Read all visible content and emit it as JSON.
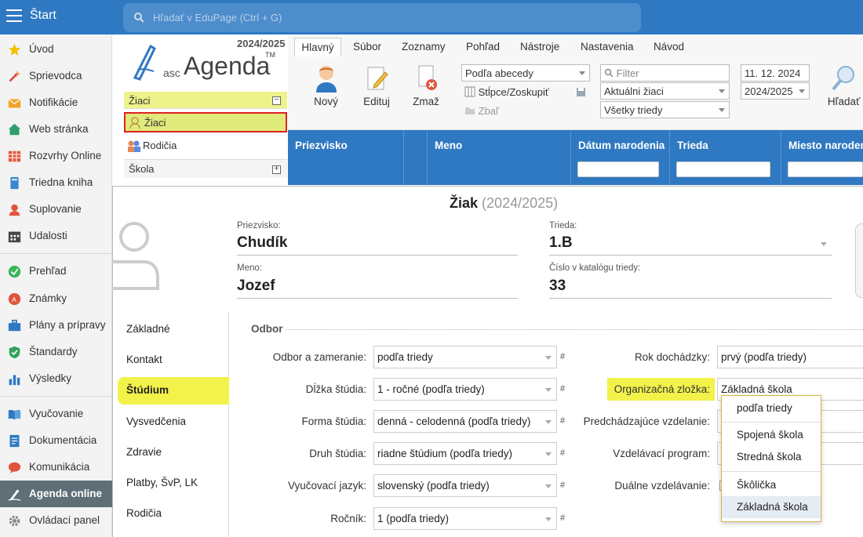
{
  "topbar": {
    "title": "Štart",
    "search_placeholder": "Hľadať v EduPage (Ctrl + G)"
  },
  "sidebar": {
    "items": [
      {
        "label": "Úvod",
        "icon": "star-icon"
      },
      {
        "label": "Sprievodca",
        "icon": "wand-icon"
      },
      {
        "label": "Notifikácie",
        "icon": "envelope-icon"
      },
      {
        "label": "Web stránka",
        "icon": "home-icon"
      },
      {
        "label": "Rozvrhy Online",
        "icon": "grid-icon"
      },
      {
        "label": "Triedna kniha",
        "icon": "book-icon"
      },
      {
        "label": "Suplovanie",
        "icon": "person-icon"
      },
      {
        "label": "Udalosti",
        "icon": "calendar-icon"
      },
      {
        "label": "Prehľad",
        "icon": "check-icon"
      },
      {
        "label": "Známky",
        "icon": "grade-icon"
      },
      {
        "label": "Plány a prípravy",
        "icon": "briefcase-icon"
      },
      {
        "label": "Štandardy",
        "icon": "shield-icon"
      },
      {
        "label": "Výsledky",
        "icon": "bar-chart-icon"
      },
      {
        "label": "Vyučovanie",
        "icon": "open-book-icon"
      },
      {
        "label": "Dokumentácia",
        "icon": "document-icon"
      },
      {
        "label": "Komunikácia",
        "icon": "chat-icon"
      },
      {
        "label": "Agenda online",
        "icon": "agenda-icon"
      },
      {
        "label": "Ovládací panel",
        "icon": "gear-icon"
      }
    ]
  },
  "nav": {
    "year": "2024/2025",
    "logo_small": "asc",
    "logo_big": "Agenda",
    "logo_tm": "TM",
    "section": "Žiaci",
    "selected": "Žiaci",
    "item_parents": "Rodičia",
    "item_school": "Škola"
  },
  "ribbon": {
    "tabs": [
      "Hlavný",
      "Súbor",
      "Zoznamy",
      "Pohľad",
      "Nástroje",
      "Nastavenia",
      "Návod"
    ],
    "btn_new": "Nový",
    "btn_edit": "Edituj",
    "btn_delete": "Zmaž",
    "sort": "Podľa abecedy",
    "columns": "Stĺpce/Zoskupiť",
    "collapse": "Zbaľ",
    "filter_placeholder": "Filter",
    "students": "Aktuálni žiaci",
    "classes": "Všetky triedy",
    "date": "11. 12. 2024",
    "year": "2024/2025",
    "btn_search": "Hľadať"
  },
  "grid": {
    "columns": [
      "Priezvisko",
      "",
      "Meno",
      "Dátum narodenia",
      "Trieda",
      "Miesto narodenia"
    ]
  },
  "modal": {
    "title": "Žiak",
    "year": "(2024/2025)",
    "lbl_surname": "Priezvisko:",
    "surname": "Chudík",
    "lbl_class": "Trieda:",
    "class": "1.B",
    "lbl_name": "Meno:",
    "name": "Jozef",
    "lbl_catalog": "Číslo v katalógu triedy:",
    "catalog": "33",
    "tabs": [
      "Základné",
      "Kontakt",
      "Štúdium",
      "Vysvedčenia",
      "Zdravie",
      "Platby, ŠvP, LK",
      "Rodičia"
    ],
    "section": "Odbor",
    "left_fields": [
      {
        "label": "Odbor a zameranie:",
        "value": "podľa triedy"
      },
      {
        "label": "Dĺžka štúdia:",
        "value": "1 - ročné (podľa triedy)"
      },
      {
        "label": "Forma štúdia:",
        "value": "denná - celodenná (podľa triedy)"
      },
      {
        "label": "Druh štúdia:",
        "value": "riadne štúdium (podľa triedy)"
      },
      {
        "label": "Vyučovací jazyk:",
        "value": "slovenský (podľa triedy)"
      },
      {
        "label": "Ročník:",
        "value": "1 (podľa triedy)"
      }
    ],
    "right_fields": [
      {
        "label": "Rok dochádzky:",
        "value": "prvý (podľa triedy)"
      },
      {
        "label": "Organizačná zložka:",
        "value": "Základná škola"
      },
      {
        "label": "Predchádzajúce vzdelanie:",
        "value": ""
      },
      {
        "label": "Vzdelávací program:",
        "value": ""
      },
      {
        "label": "Duálne vzdelávanie:",
        "value": ""
      }
    ],
    "hash": "#",
    "dropdown": [
      "podľa triedy",
      "Spojená škola",
      "Stredná škola",
      "Škôlička",
      "Základná škola"
    ]
  }
}
